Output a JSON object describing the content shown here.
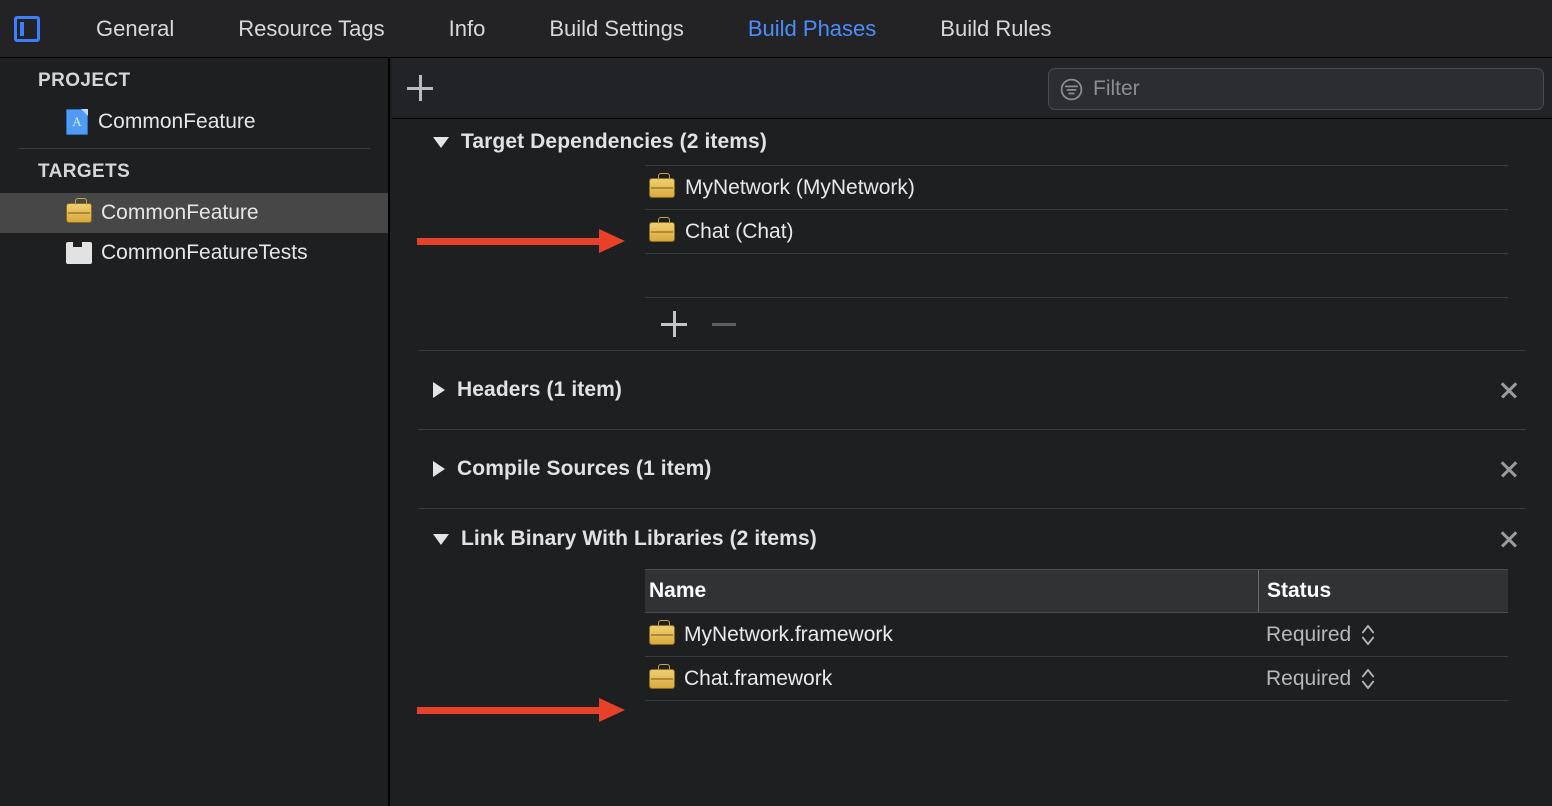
{
  "window": {
    "editor_icon": "editor-layout-icon",
    "tabs": [
      {
        "label": "General",
        "active": false
      },
      {
        "label": "Resource Tags",
        "active": false
      },
      {
        "label": "Info",
        "active": false
      },
      {
        "label": "Build Settings",
        "active": false
      },
      {
        "label": "Build Phases",
        "active": true
      },
      {
        "label": "Build Rules",
        "active": false
      }
    ]
  },
  "sidebar": {
    "project_group_label": "PROJECT",
    "project_items": [
      {
        "label": "CommonFeature",
        "icon": "xcode-project-icon"
      }
    ],
    "targets_group_label": "TARGETS",
    "target_items": [
      {
        "label": "CommonFeature",
        "icon": "framework-toolbox-icon",
        "selected": true
      },
      {
        "label": "CommonFeatureTests",
        "icon": "unit-test-bundle-icon",
        "selected": false
      }
    ]
  },
  "toolbar": {
    "add_label": "+",
    "filter_placeholder": "Filter",
    "filter_value": "",
    "filter_icon": "filter-circle-icon"
  },
  "phases": [
    {
      "title": "Target Dependencies (2 items)",
      "expanded": true,
      "closable": false,
      "items": [
        {
          "name": "MyNetwork",
          "paren": "(MyNetwork)",
          "icon": "framework-toolbox-icon"
        },
        {
          "name": "Chat",
          "paren": "(Chat)",
          "icon": "framework-toolbox-icon"
        }
      ],
      "add_label": "+",
      "remove_label": "—"
    },
    {
      "title": "Headers (1 item)",
      "expanded": false,
      "closable": true
    },
    {
      "title": "Compile Sources (1 item)",
      "expanded": false,
      "closable": true
    },
    {
      "title": "Link Binary With Libraries (2 items)",
      "expanded": true,
      "closable": true,
      "columns": [
        "Name",
        "Status"
      ],
      "rows": [
        {
          "name": "MyNetwork.framework",
          "status": "Required",
          "icon": "framework-toolbox-icon"
        },
        {
          "name": "Chat.framework",
          "status": "Required",
          "icon": "framework-toolbox-icon"
        }
      ]
    }
  ],
  "annotations": {
    "arrow_color": "#e8412a",
    "arrows": [
      {
        "name": "arrow-to-target-dependencies"
      },
      {
        "name": "arrow-to-linked-frameworks"
      }
    ]
  }
}
